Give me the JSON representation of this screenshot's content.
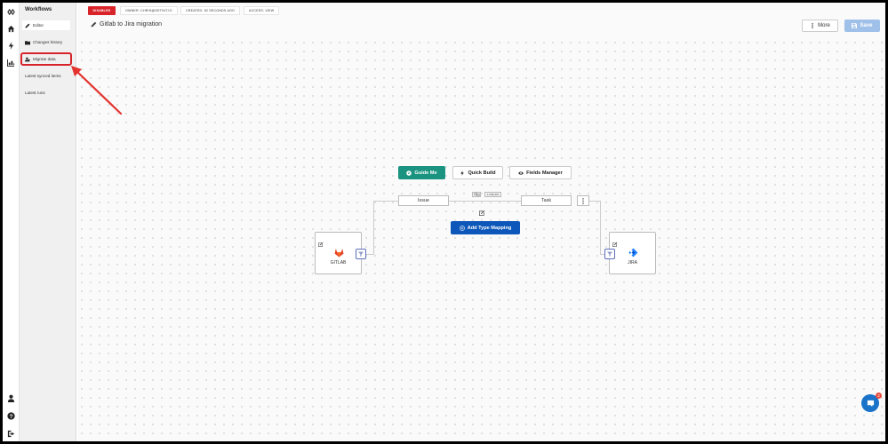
{
  "sidebar": {
    "title": "Workflows",
    "items": [
      {
        "label": "Editor",
        "icon": "pencil-icon"
      },
      {
        "label": "Changes history",
        "icon": "folder-icon"
      },
      {
        "label": "Migrate data",
        "icon": "user-upload-icon"
      },
      {
        "label": "Latest synced items",
        "icon": ""
      },
      {
        "label": "Latest runs",
        "icon": ""
      }
    ]
  },
  "rail": {
    "top_icons": [
      "logo-icon",
      "home-icon",
      "bolt-icon",
      "chart-icon"
    ],
    "bottom_icons": [
      "user-icon",
      "help-icon",
      "logout-icon"
    ]
  },
  "header": {
    "status": "DISABLED",
    "owner": "OWNER: CHRIS@GETINT.IO",
    "created": "CREATED: 52 SECONDS AGO",
    "access": "ACCESS: VIEW",
    "workflow_title": "Gitlab to Jira migration",
    "more_label": "More",
    "save_label": "Save"
  },
  "canvas": {
    "guide_label": "Guide Me",
    "quick_label": "Quick Build",
    "fields_label": "Fields Manager",
    "left_type": "Issue",
    "right_type": "Task",
    "mini_label": "1 FIELDS",
    "add_mapping_label": "Add Type Mapping",
    "left_app": "GITLAB",
    "right_app": "JIRA"
  },
  "chat": {
    "unread": "2"
  },
  "colors": {
    "disabled": "#d8232a",
    "guide": "#1a9380",
    "primary": "#0c57b9",
    "save_disabled": "#9fc0e8",
    "annotation": "#d8232a"
  }
}
